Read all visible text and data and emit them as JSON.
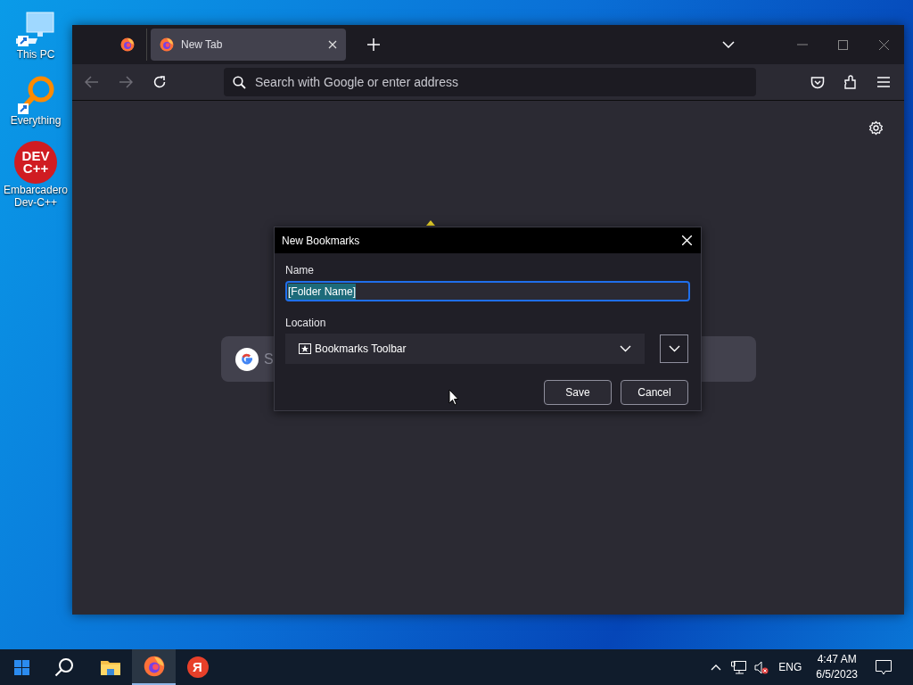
{
  "desktop_icons": [
    {
      "kind": "pc",
      "label": "This PC"
    },
    {
      "kind": "everything",
      "label": "Everything"
    },
    {
      "kind": "devcpp",
      "label": "Embarcadero Dev-C++",
      "logo_lines": [
        "DEV",
        "C++"
      ]
    }
  ],
  "browser": {
    "tabs": [
      {
        "kind": "pinned",
        "selected": false
      },
      {
        "kind": "tab",
        "title": "New Tab",
        "selected": true
      }
    ],
    "address_placeholder": "Search with Google or enter address",
    "search_box": {
      "placeholder": "S"
    }
  },
  "dialog": {
    "title": "New Bookmarks",
    "name_label": "Name",
    "name_value": "[Folder Name]",
    "text_selected": true,
    "location_label": "Location",
    "location_value": "Bookmarks Toolbar",
    "buttons": [
      "Save",
      "Cancel"
    ]
  },
  "taskbar": {
    "apps": [
      {
        "kind": "explorer",
        "selected": false
      },
      {
        "kind": "firefox",
        "selected": true
      },
      {
        "kind": "yandex",
        "selected": false,
        "letter": "Я"
      }
    ],
    "language": "ENG",
    "time": "4:47 AM",
    "date": "6/5/2023"
  }
}
